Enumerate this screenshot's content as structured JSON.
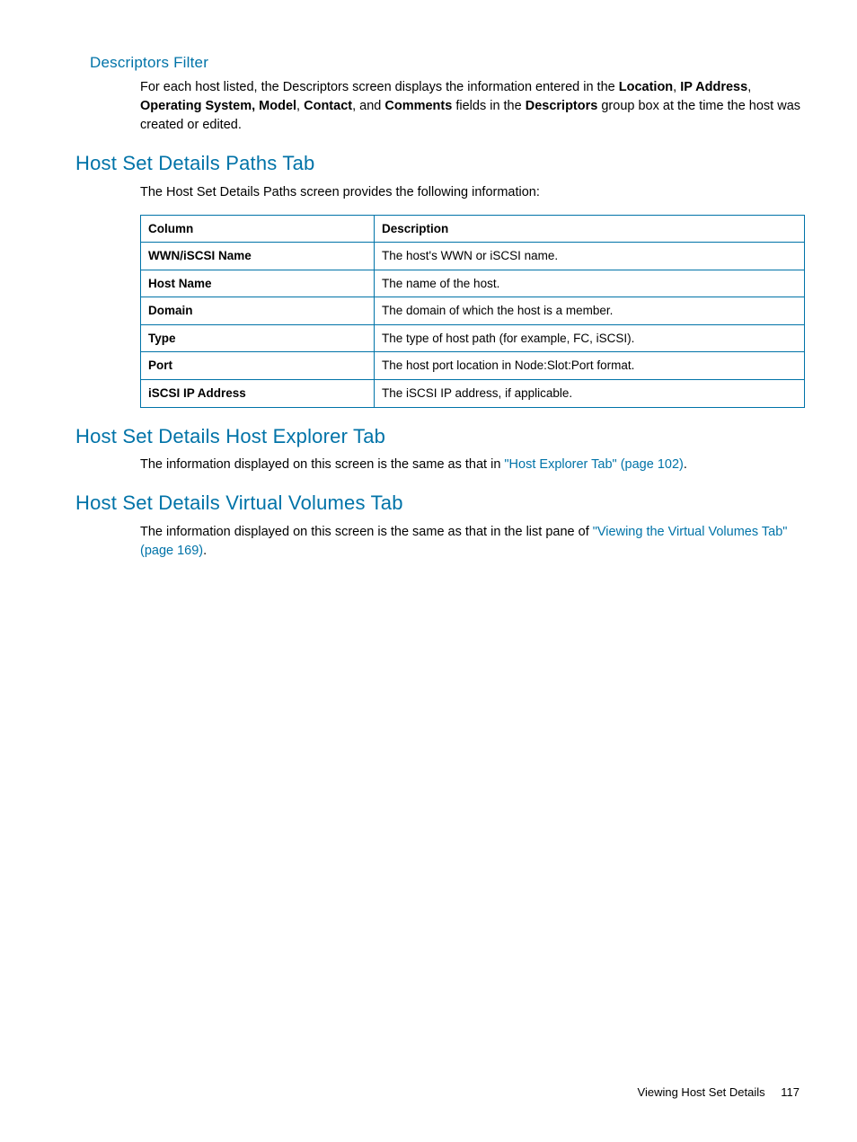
{
  "s1": {
    "heading": "Descriptors Filter",
    "para_pre": "For each host listed, the Descriptors screen displays the information entered in the ",
    "b1": "Location",
    "sep1": ", ",
    "b2": "IP Address",
    "sep2": ", ",
    "b3": "Operating System, Model",
    "sep3": ", ",
    "b4": "Contact",
    "sep4": ", and ",
    "b5": "Comments",
    "sep5": " fields in the ",
    "b6": "Descriptors",
    "para_post": " group box at the time the host was created or edited."
  },
  "s2": {
    "heading": "Host Set Details Paths Tab",
    "intro": "The Host Set Details Paths screen provides the following information:",
    "th1": "Column",
    "th2": "Description",
    "rows": [
      {
        "c": "WWN/iSCSI Name",
        "d": "The host's WWN or iSCSI name."
      },
      {
        "c": "Host Name",
        "d": "The name of the host."
      },
      {
        "c": "Domain",
        "d": "The domain of which the host is a member."
      },
      {
        "c": "Type",
        "d": "The type of host path (for example, FC, iSCSI)."
      },
      {
        "c": "Port",
        "d": "The host port location in Node:Slot:Port format."
      },
      {
        "c": "iSCSI IP Address",
        "d": "The iSCSI IP address, if applicable."
      }
    ]
  },
  "s3": {
    "heading": "Host Set Details Host Explorer Tab",
    "para_pre": "The information displayed on this screen is the same as that in ",
    "link": "\"Host Explorer Tab\" (page 102)",
    "para_post": "."
  },
  "s4": {
    "heading": "Host Set Details Virtual Volumes Tab",
    "para_pre": "The information displayed on this screen is the same as that in the list pane of ",
    "link": "\"Viewing the Virtual Volumes Tab\" (page 169)",
    "para_post": "."
  },
  "footer": {
    "text": "Viewing Host Set Details",
    "page": "117"
  }
}
